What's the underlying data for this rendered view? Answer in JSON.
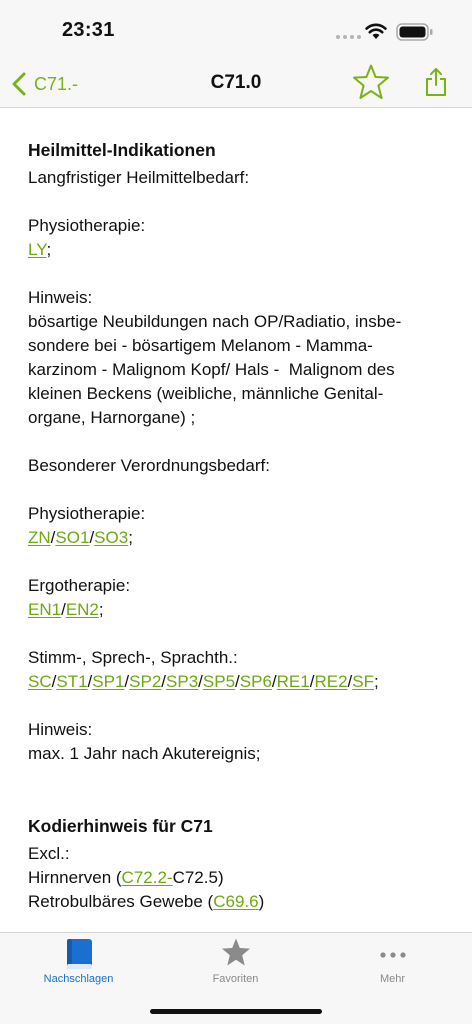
{
  "status": {
    "time": "23:31"
  },
  "nav": {
    "back_label": "C71.-",
    "title": "C71.0"
  },
  "section1": {
    "heading": "Heilmittel-Indikationen",
    "intro": "Langfristiger Heilmittelbedarf:",
    "physio1_label": "Physiotherapie:",
    "physio1_codes": [
      "LY"
    ],
    "note_label": "Hinweis:",
    "note_lines": [
      "bösartige Neubildungen nach OP/Radiatio, insbe-",
      "sondere bei - bösartigem Melanom - Mamma-",
      "karzinom - Malignom Kopf/ Hals -  Malignom des",
      "kleinen Beckens (weibliche, männliche Genital-",
      "organe, Harnorgane) ;"
    ],
    "special_label": "Besonderer Verordnungsbedarf:",
    "physio2_label": "Physiotherapie:",
    "physio2_codes": [
      "ZN",
      "SO1",
      "SO3"
    ],
    "ergo_label": "Ergotherapie:",
    "ergo_codes": [
      "EN1",
      "EN2"
    ],
    "speech_label": "Stimm-, Sprech-, Sprachth.:",
    "speech_codes": [
      "SC",
      "ST1",
      "SP1",
      "SP2",
      "SP3",
      "SP5",
      "SP6",
      "RE1",
      "RE2",
      "SF"
    ],
    "note2_label": "Hinweis:",
    "note2_text": "max. 1 Jahr nach Akutereignis;"
  },
  "section2": {
    "heading": "Kodierhinweis für C71",
    "excl_label": "Excl.:",
    "row1_prefix": "Hirnnerven (",
    "row1_code": "C72.2-",
    "row1_suffix": "C72.5)",
    "row2_prefix": "Retrobulbäres Gewebe (",
    "row2_code": "C69.6",
    "row2_suffix": ")"
  },
  "tabs": [
    {
      "label": "Nachschlagen",
      "icon": "book-icon",
      "active": true
    },
    {
      "label": "Favoriten",
      "icon": "star-icon",
      "active": false
    },
    {
      "label": "Mehr",
      "icon": "more-icon",
      "active": false
    }
  ],
  "colors": {
    "accent": "#7ab317",
    "tab_active": "#1a6fd1",
    "tab_inactive": "#8a8a8a"
  }
}
